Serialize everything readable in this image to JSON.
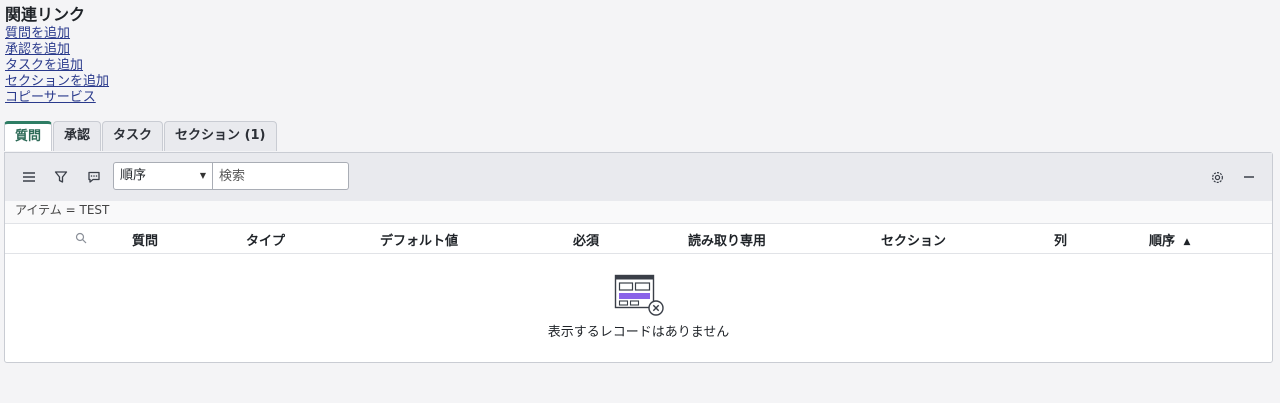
{
  "related": {
    "title": "関連リンク",
    "links": [
      "質問を追加",
      "承認を追加",
      "タスクを追加",
      "セクションを追加",
      "コピーサービス"
    ]
  },
  "tabs": [
    "質問",
    "承認",
    "タスク",
    "セクション (1)"
  ],
  "toolbar": {
    "sort_select": "順序",
    "search_placeholder": "検索"
  },
  "filter": "アイテム = TEST",
  "columns": [
    "質問",
    "タイプ",
    "デフォルト値",
    "必須",
    "読み取り専用",
    "セクション",
    "列",
    "順序"
  ],
  "sort_indicator": "▲",
  "empty_message": "表示するレコードはありません",
  "colors": {
    "accent": "#2e7d64",
    "link": "#2a3a8c",
    "empty_bar": "#8a63e8"
  }
}
